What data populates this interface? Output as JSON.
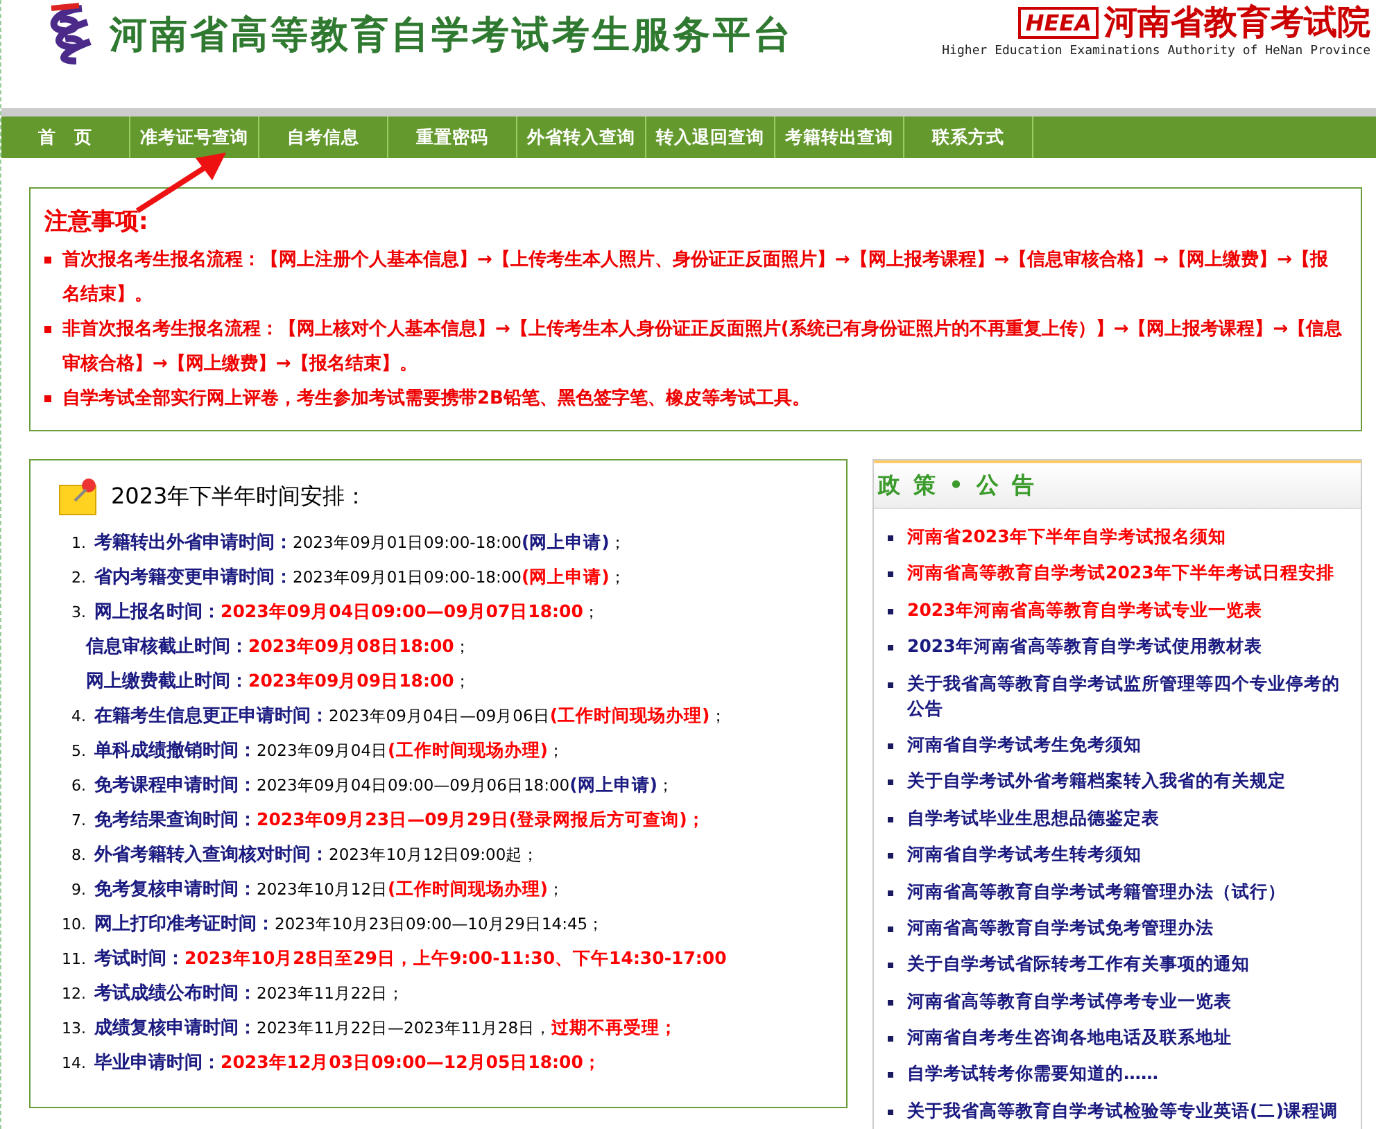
{
  "header": {
    "title": "河南省高等教育自学考试考生服务平台",
    "org_logo": "HEEA",
    "org_name": "河南省教育考试院",
    "org_name_en": "Higher Education Examinations Authority of HeNan Province"
  },
  "nav": [
    {
      "label": "首　页",
      "selected": false
    },
    {
      "label": "准考证号查询",
      "selected": false
    },
    {
      "label": "自考信息",
      "selected": false
    },
    {
      "label": "重置密码",
      "selected": false
    },
    {
      "label": "外省转入查询",
      "selected": false
    },
    {
      "label": "转入退回查询",
      "selected": false
    },
    {
      "label": "考籍转出查询",
      "selected": false
    },
    {
      "label": "联系方式",
      "selected": false
    }
  ],
  "notice": {
    "title": "注意事项:",
    "items": [
      "首次报名考生报名流程：【网上注册个人基本信息】→【上传考生本人照片、身份证正反面照片】→【网上报考课程】→【信息审核合格】→【网上缴费】→【报名结束】。",
      "非首次报名考生报名流程：【网上核对个人基本信息】→【上传考生本人身份证正反面照片(系统已有身份证照片的不再重复上传）】→【网上报考课程】→【信息审核合格】→【网上缴费】→【报名结束】。",
      "自学考试全部实行网上评卷，考生参加考试需要携带2B铅笔、黑色签字笔、橡皮等考试工具。"
    ]
  },
  "schedule": {
    "title": "2023年下半年时间安排：",
    "items": [
      {
        "number": "1.",
        "label": "考籍转出外省申请时间：",
        "parts": [
          {
            "kind": "plain",
            "text": "2023年09月01日09:00-18:00"
          },
          {
            "kind": "blue",
            "text": "(网上申请)"
          },
          {
            "kind": "plain",
            "text": "；"
          }
        ]
      },
      {
        "number": "2.",
        "label": "省内考籍变更申请时间：",
        "parts": [
          {
            "kind": "plain",
            "text": "2023年09月01日09:00-18:00"
          },
          {
            "kind": "red",
            "text": "(网上申请)"
          },
          {
            "kind": "plain",
            "text": "；"
          }
        ]
      },
      {
        "number": "3.",
        "label": "网上报名时间：",
        "parts": [
          {
            "kind": "red",
            "text": "2023年09月04日09:00—09月07日18:00"
          },
          {
            "kind": "plain",
            "text": "；"
          }
        ],
        "children": [
          {
            "label": "信息审核截止时间：",
            "parts": [
              {
                "kind": "red",
                "text": "2023年09月08日18:00"
              },
              {
                "kind": "plain",
                "text": "；"
              }
            ]
          },
          {
            "label": "网上缴费截止时间：",
            "parts": [
              {
                "kind": "red",
                "text": "2023年09月09日18:00"
              },
              {
                "kind": "plain",
                "text": "；"
              }
            ]
          }
        ]
      },
      {
        "number": "4.",
        "label": "在籍考生信息更正申请时间：",
        "parts": [
          {
            "kind": "plain",
            "text": "2023年09月04日—09月06日"
          },
          {
            "kind": "red",
            "text": "(工作时间现场办理)"
          },
          {
            "kind": "plain",
            "text": "；"
          }
        ]
      },
      {
        "number": "5.",
        "label": "单科成绩撤销时间：",
        "parts": [
          {
            "kind": "plain",
            "text": "2023年09月04日"
          },
          {
            "kind": "red",
            "text": "(工作时间现场办理)"
          },
          {
            "kind": "plain",
            "text": "；"
          }
        ]
      },
      {
        "number": "6.",
        "label": "免考课程申请时间：",
        "parts": [
          {
            "kind": "plain",
            "text": "2023年09月04日09:00—09月06日18:00"
          },
          {
            "kind": "blue",
            "text": "(网上申请)"
          },
          {
            "kind": "plain",
            "text": "；"
          }
        ]
      },
      {
        "number": "7.",
        "label": "免考结果查询时间：",
        "parts": [
          {
            "kind": "red",
            "text": "2023年09月23日—09月29日(登录网报后方可查询)；"
          }
        ]
      },
      {
        "number": "8.",
        "label": "外省考籍转入查询核对时间：",
        "parts": [
          {
            "kind": "plain",
            "text": "2023年10月12日09:00起；"
          }
        ]
      },
      {
        "number": "9.",
        "label": "免考复核申请时间：",
        "parts": [
          {
            "kind": "plain",
            "text": "2023年10月12日"
          },
          {
            "kind": "red",
            "text": "(工作时间现场办理)"
          },
          {
            "kind": "plain",
            "text": "；"
          }
        ]
      },
      {
        "number": "10.",
        "label": "网上打印准考证时间：",
        "parts": [
          {
            "kind": "plain",
            "text": "2023年10月23日09:00—10月29日14:45；"
          }
        ]
      },
      {
        "number": "11.",
        "label": "考试时间：",
        "parts": [
          {
            "kind": "red",
            "text": "2023年10月28日至29日，上午9:00-11:30、下午14:30-17:00"
          }
        ]
      },
      {
        "number": "12.",
        "label": "考试成绩公布时间：",
        "parts": [
          {
            "kind": "plain",
            "text": "2023年11月22日；"
          }
        ]
      },
      {
        "number": "13.",
        "label": "成绩复核申请时间：",
        "parts": [
          {
            "kind": "plain",
            "text": "2023年11月22日—2023年11月28日，"
          },
          {
            "kind": "red",
            "text": "过期不再受理；"
          }
        ]
      },
      {
        "number": "14.",
        "label": "毕业申请时间：",
        "parts": [
          {
            "kind": "red",
            "text": "2023年12月03日09:00—12月05日18:00；"
          }
        ]
      }
    ]
  },
  "policy": {
    "title": "政 策 • 公 告",
    "items": [
      {
        "text": "河南省2023年下半年自学考试报名须知",
        "color": "#ff0000"
      },
      {
        "text": "河南省高等教育自学考试2023年下半年考试日程安排",
        "color": "#ff0000"
      },
      {
        "text": "2023年河南省高等教育自学考试专业一览表",
        "color": "#ff0000"
      },
      {
        "text": "2023年河南省高等教育自学考试使用教材表",
        "color": "#1a1a80"
      },
      {
        "text": "关于我省高等教育自学考试监所管理等四个专业停考的公告",
        "color": "#1a1a80"
      },
      {
        "text": "河南省自学考试考生免考须知",
        "color": "#1a1a80"
      },
      {
        "text": "关于自学考试外省考籍档案转入我省的有关规定",
        "color": "#1a1a80"
      },
      {
        "text": "自学考试毕业生思想品德鉴定表",
        "color": "#1a1a80"
      },
      {
        "text": "河南省自学考试考生转考须知",
        "color": "#1a1a80"
      },
      {
        "text": "河南省高等教育自学考试考籍管理办法（试行）",
        "color": "#1a1a80"
      },
      {
        "text": "河南省高等教育自学考试免考管理办法",
        "color": "#1a1a80"
      },
      {
        "text": "关于自学考试省际转考工作有关事项的通知",
        "color": "#1a1a80"
      },
      {
        "text": "河南省高等教育自学考试停考专业一览表",
        "color": "#1a1a80"
      },
      {
        "text": "河南省自考考生咨询各地电话及联系地址",
        "color": "#1a1a80"
      },
      {
        "text": "自学考试转考你需要知道的……",
        "color": "#1a1a80"
      },
      {
        "text": "关于我省高等教育自学考试检验等专业英语(二)课程调",
        "color": "#1a1a80"
      }
    ]
  }
}
